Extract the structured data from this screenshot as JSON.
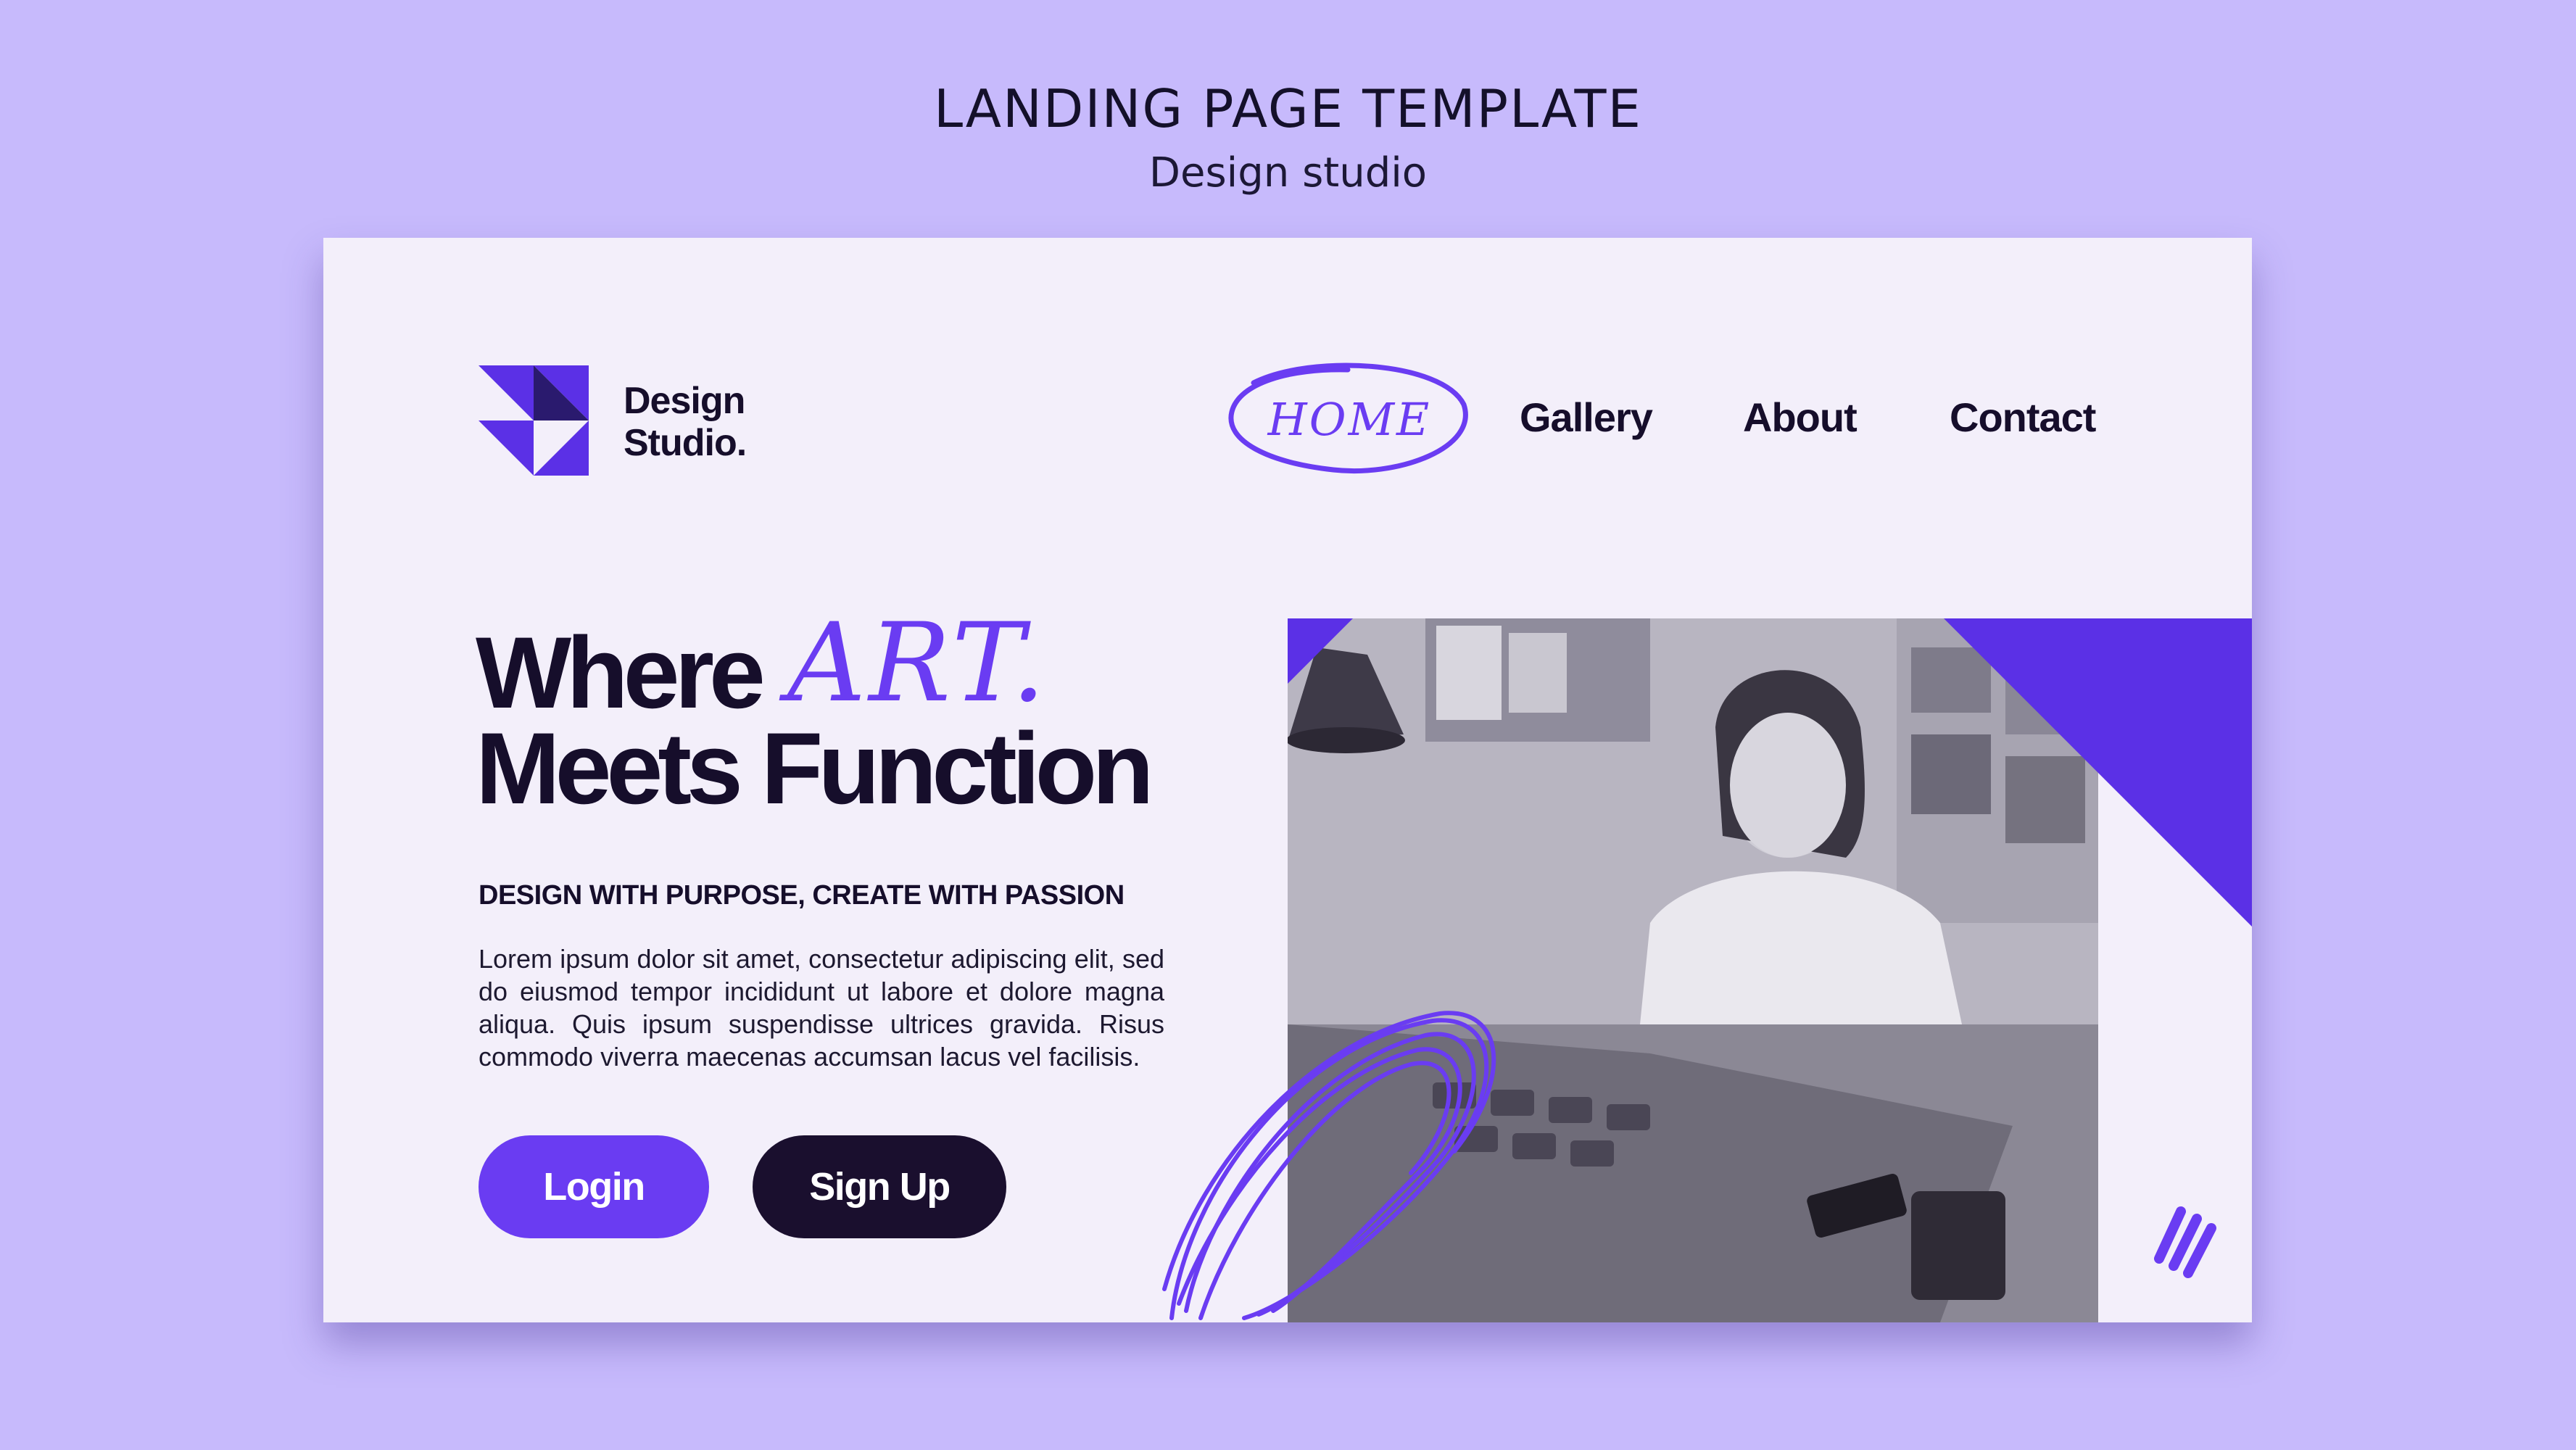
{
  "header": {
    "title": "LANDING PAGE TEMPLATE",
    "subtitle": "Design studio"
  },
  "brand": {
    "logo_icon": "triangles-logo-icon",
    "name_line1": "Design",
    "name_line2": "Studio."
  },
  "nav": {
    "items": [
      {
        "label": "HOME",
        "active": true
      },
      {
        "label": "Gallery"
      },
      {
        "label": "About"
      },
      {
        "label": "Contact"
      }
    ]
  },
  "hero": {
    "headline_line1": "Where",
    "headline_accent": "ART.",
    "headline_line2": "Meets Function",
    "tagline": "DESIGN WITH PURPOSE, CREATE WITH PASSION",
    "body": "Lorem ipsum dolor sit amet, consectetur adipiscing elit, sed do eiusmod tempor incididunt ut labore et dolore magna aliqua. Quis ipsum suspendisse ultrices gravida. Risus commodo viverra maecenas accumsan lacus vel facilisis."
  },
  "buttons": {
    "login": "Login",
    "signup": "Sign Up"
  },
  "colors": {
    "background": "#c7bafc",
    "card": "#f3effa",
    "accent": "#6a3cf2",
    "dark": "#160e2b"
  }
}
